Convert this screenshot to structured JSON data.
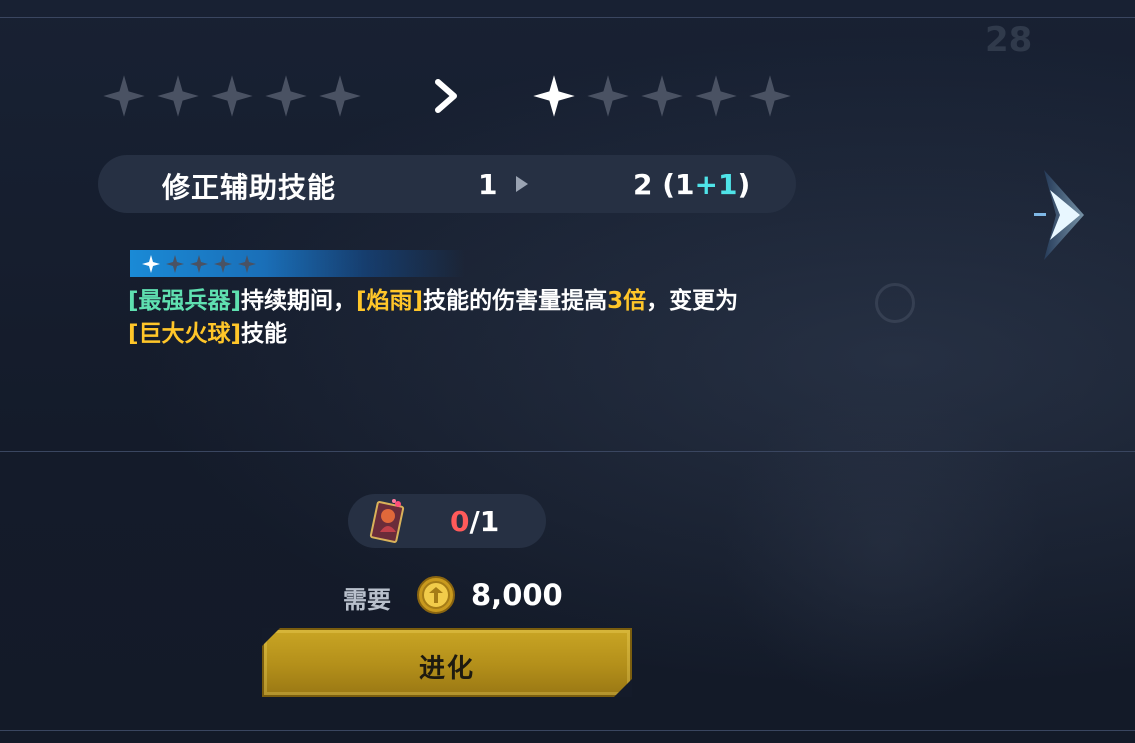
{
  "current_stars": {
    "filled": 0,
    "total": 5
  },
  "next_stars": {
    "filled": 1,
    "total": 5
  },
  "skill": {
    "name": "修正辅助技能",
    "level_from": "1",
    "level_to": "2 (",
    "level_base": "1",
    "level_bonus": "+1",
    "level_close": ")"
  },
  "description": {
    "star_tier": {
      "filled": 1,
      "total": 5
    },
    "part1": "[最强兵器]",
    "part2": "持续期间，",
    "part3": "[焰雨]",
    "part4": "技能的伤害量提高",
    "part5": "3倍",
    "part6": "，变更为",
    "part7": "[巨大火球]",
    "part8": "技能"
  },
  "material": {
    "have": "0",
    "need": "/1"
  },
  "cost": {
    "label": "需要",
    "amount": "8,000"
  },
  "evolve_button": {
    "label": "进化"
  },
  "colors": {
    "accent_cyan": "#4fe3e8",
    "highlight_green": "#5fe0b0",
    "highlight_gold": "#ffc629",
    "insufficient_red": "#ff5a5a",
    "button_gold": "#c9a524"
  },
  "icons": [
    "star-icon",
    "chevron-right-icon",
    "material-card-icon",
    "gold-coin-icon",
    "next-page-arrow-icon"
  ]
}
